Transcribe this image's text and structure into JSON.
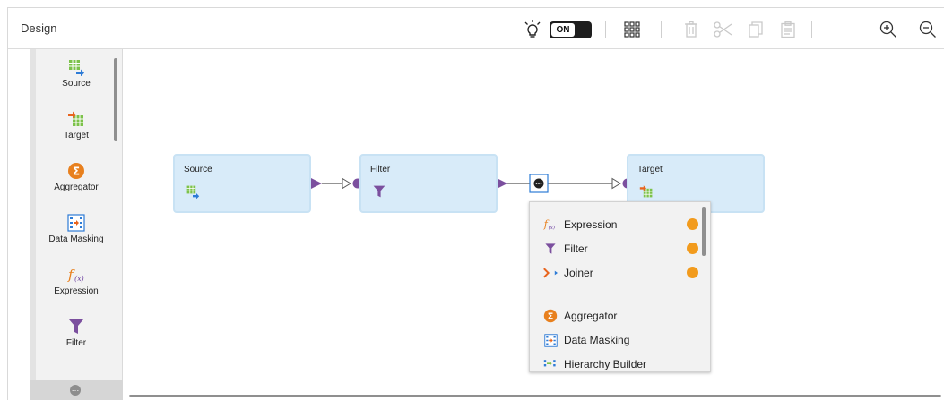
{
  "header": {
    "title": "Design",
    "toggle_label": "ON",
    "tools": [
      "recommendation-bulb-icon",
      "grid-icon",
      "trash-icon",
      "scissors-icon",
      "copy-icon",
      "paste-icon",
      "zoom-in-icon",
      "zoom-out-icon"
    ]
  },
  "palette": {
    "items": [
      {
        "label": "Source",
        "icon": "source-icon"
      },
      {
        "label": "Target",
        "icon": "target-icon"
      },
      {
        "label": "Aggregator",
        "icon": "aggregator-icon"
      },
      {
        "label": "Data Masking",
        "icon": "data-masking-icon"
      },
      {
        "label": "Expression",
        "icon": "expression-icon"
      },
      {
        "label": "Filter",
        "icon": "filter-icon"
      }
    ],
    "more_icon": "more-icon"
  },
  "canvas": {
    "nodes": [
      {
        "label": "Source"
      },
      {
        "label": "Filter"
      },
      {
        "label": "Target"
      }
    ]
  },
  "menu": {
    "items": [
      {
        "label": "Expression",
        "recommended": true
      },
      {
        "label": "Filter",
        "recommended": true
      },
      {
        "label": "Joiner",
        "recommended": true
      },
      {
        "label": "Aggregator",
        "recommended": false
      },
      {
        "label": "Data Masking",
        "recommended": false
      },
      {
        "label": "Hierarchy Builder",
        "recommended": false
      }
    ]
  },
  "colors": {
    "node_fill": "#d8ebf9",
    "connector": "#7b4f9e",
    "recommend_badge": "#f29b1d",
    "aggregator_orange": "#e8801e"
  }
}
